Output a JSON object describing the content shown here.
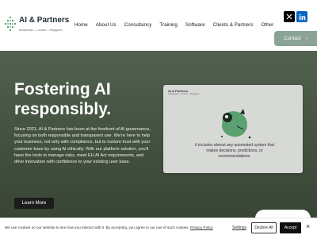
{
  "brand": {
    "name": "AI & Partners",
    "tagline": "Amsterdam – London – Singapore",
    "accent_color": "#4a9a6b"
  },
  "nav": {
    "items": [
      {
        "label": "Home"
      },
      {
        "label": "About Us"
      },
      {
        "label": "Consultancy"
      },
      {
        "label": "Training"
      },
      {
        "label": "Software"
      },
      {
        "label": "Clients & Partners"
      },
      {
        "label": "Other"
      }
    ]
  },
  "social": {
    "x_icon": "x-icon",
    "linkedin_icon": "linkedin-icon"
  },
  "contact": {
    "label": "Contact",
    "arrow": "›"
  },
  "hero": {
    "title": "Fostering AI responsibly.",
    "body": "Since 2021, AI & Partners has been at the forefront of AI governance, focusing on both responsible and transparent use. We’re here to help your business, not only with compliance, but to nurture trust with your customer base by using AI ethically. With our platform solution, you’ll have the tools to manage risks, meet EU AI Act requirements, and drive innovation with confidence to your existing user base.",
    "cta_label": "Learn More",
    "background_color": "#4b5b48"
  },
  "card": {
    "brand_label": "AI & Partners",
    "brand_sub": "Amsterdam – London – Singapore",
    "caption": "It includes almost any automated system that makes decisions, predictions, or recommendations.",
    "mascot_color": "#5aa070"
  },
  "cookie": {
    "text": "We use cookies on our website to see how you interact with it. By accepting, you agree to our use of such cookies.",
    "policy_label": "Privacy Policy",
    "settings_label": "Settings",
    "decline_label": "Decline All",
    "accept_label": "Accept",
    "close_glyph": "×"
  }
}
